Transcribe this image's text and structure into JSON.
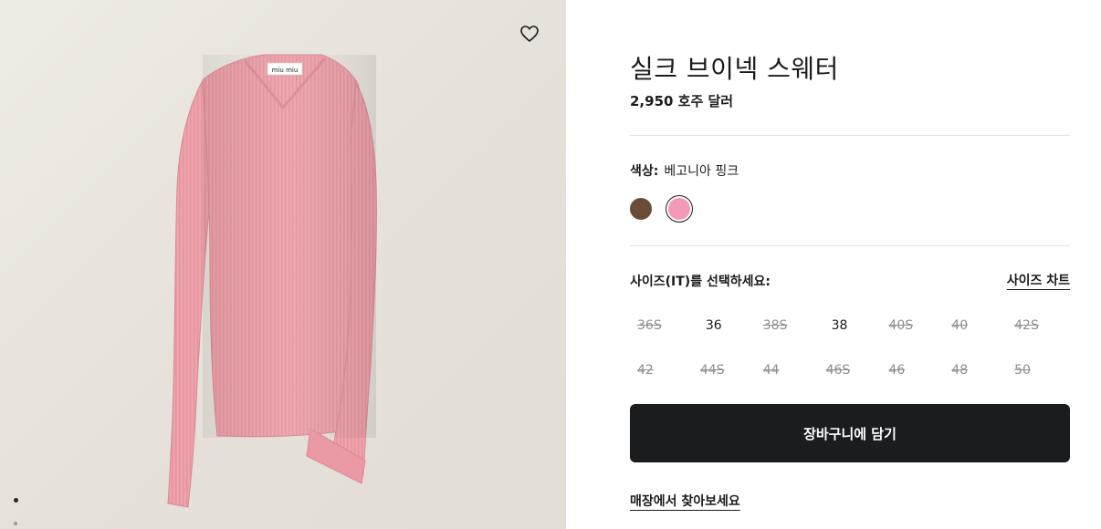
{
  "product": {
    "title": "실크 브이넥 스웨터",
    "price": "2,950 호주 달러",
    "image_label": "miu miu"
  },
  "color": {
    "label": "색상:",
    "value": "베고니아 핑크",
    "swatches": [
      {
        "name": "brown",
        "hex": "#6a4c38",
        "selected": false
      },
      {
        "name": "begonia-pink",
        "hex": "#f39ab8",
        "selected": true
      }
    ]
  },
  "sizes": {
    "heading": "사이즈(IT)를 선택하세요:",
    "chart_link": "사이즈 차트",
    "options": [
      {
        "label": "36S",
        "available": false
      },
      {
        "label": "36",
        "available": true
      },
      {
        "label": "38S",
        "available": false
      },
      {
        "label": "38",
        "available": true
      },
      {
        "label": "40S",
        "available": false
      },
      {
        "label": "40",
        "available": false
      },
      {
        "label": "42S",
        "available": false
      },
      {
        "label": "42",
        "available": false
      },
      {
        "label": "44S",
        "available": false
      },
      {
        "label": "44",
        "available": false
      },
      {
        "label": "46S",
        "available": false
      },
      {
        "label": "46",
        "available": false
      },
      {
        "label": "48",
        "available": false
      },
      {
        "label": "50",
        "available": false
      }
    ]
  },
  "actions": {
    "add_to_bag": "장바구니에 담기",
    "find_in_store": "매장에서 찾아보세요"
  },
  "icons": {
    "wishlist": "heart-icon"
  },
  "colors": {
    "button_bg": "#1b1c1e",
    "unavailable_text": "#8f8f8f"
  }
}
